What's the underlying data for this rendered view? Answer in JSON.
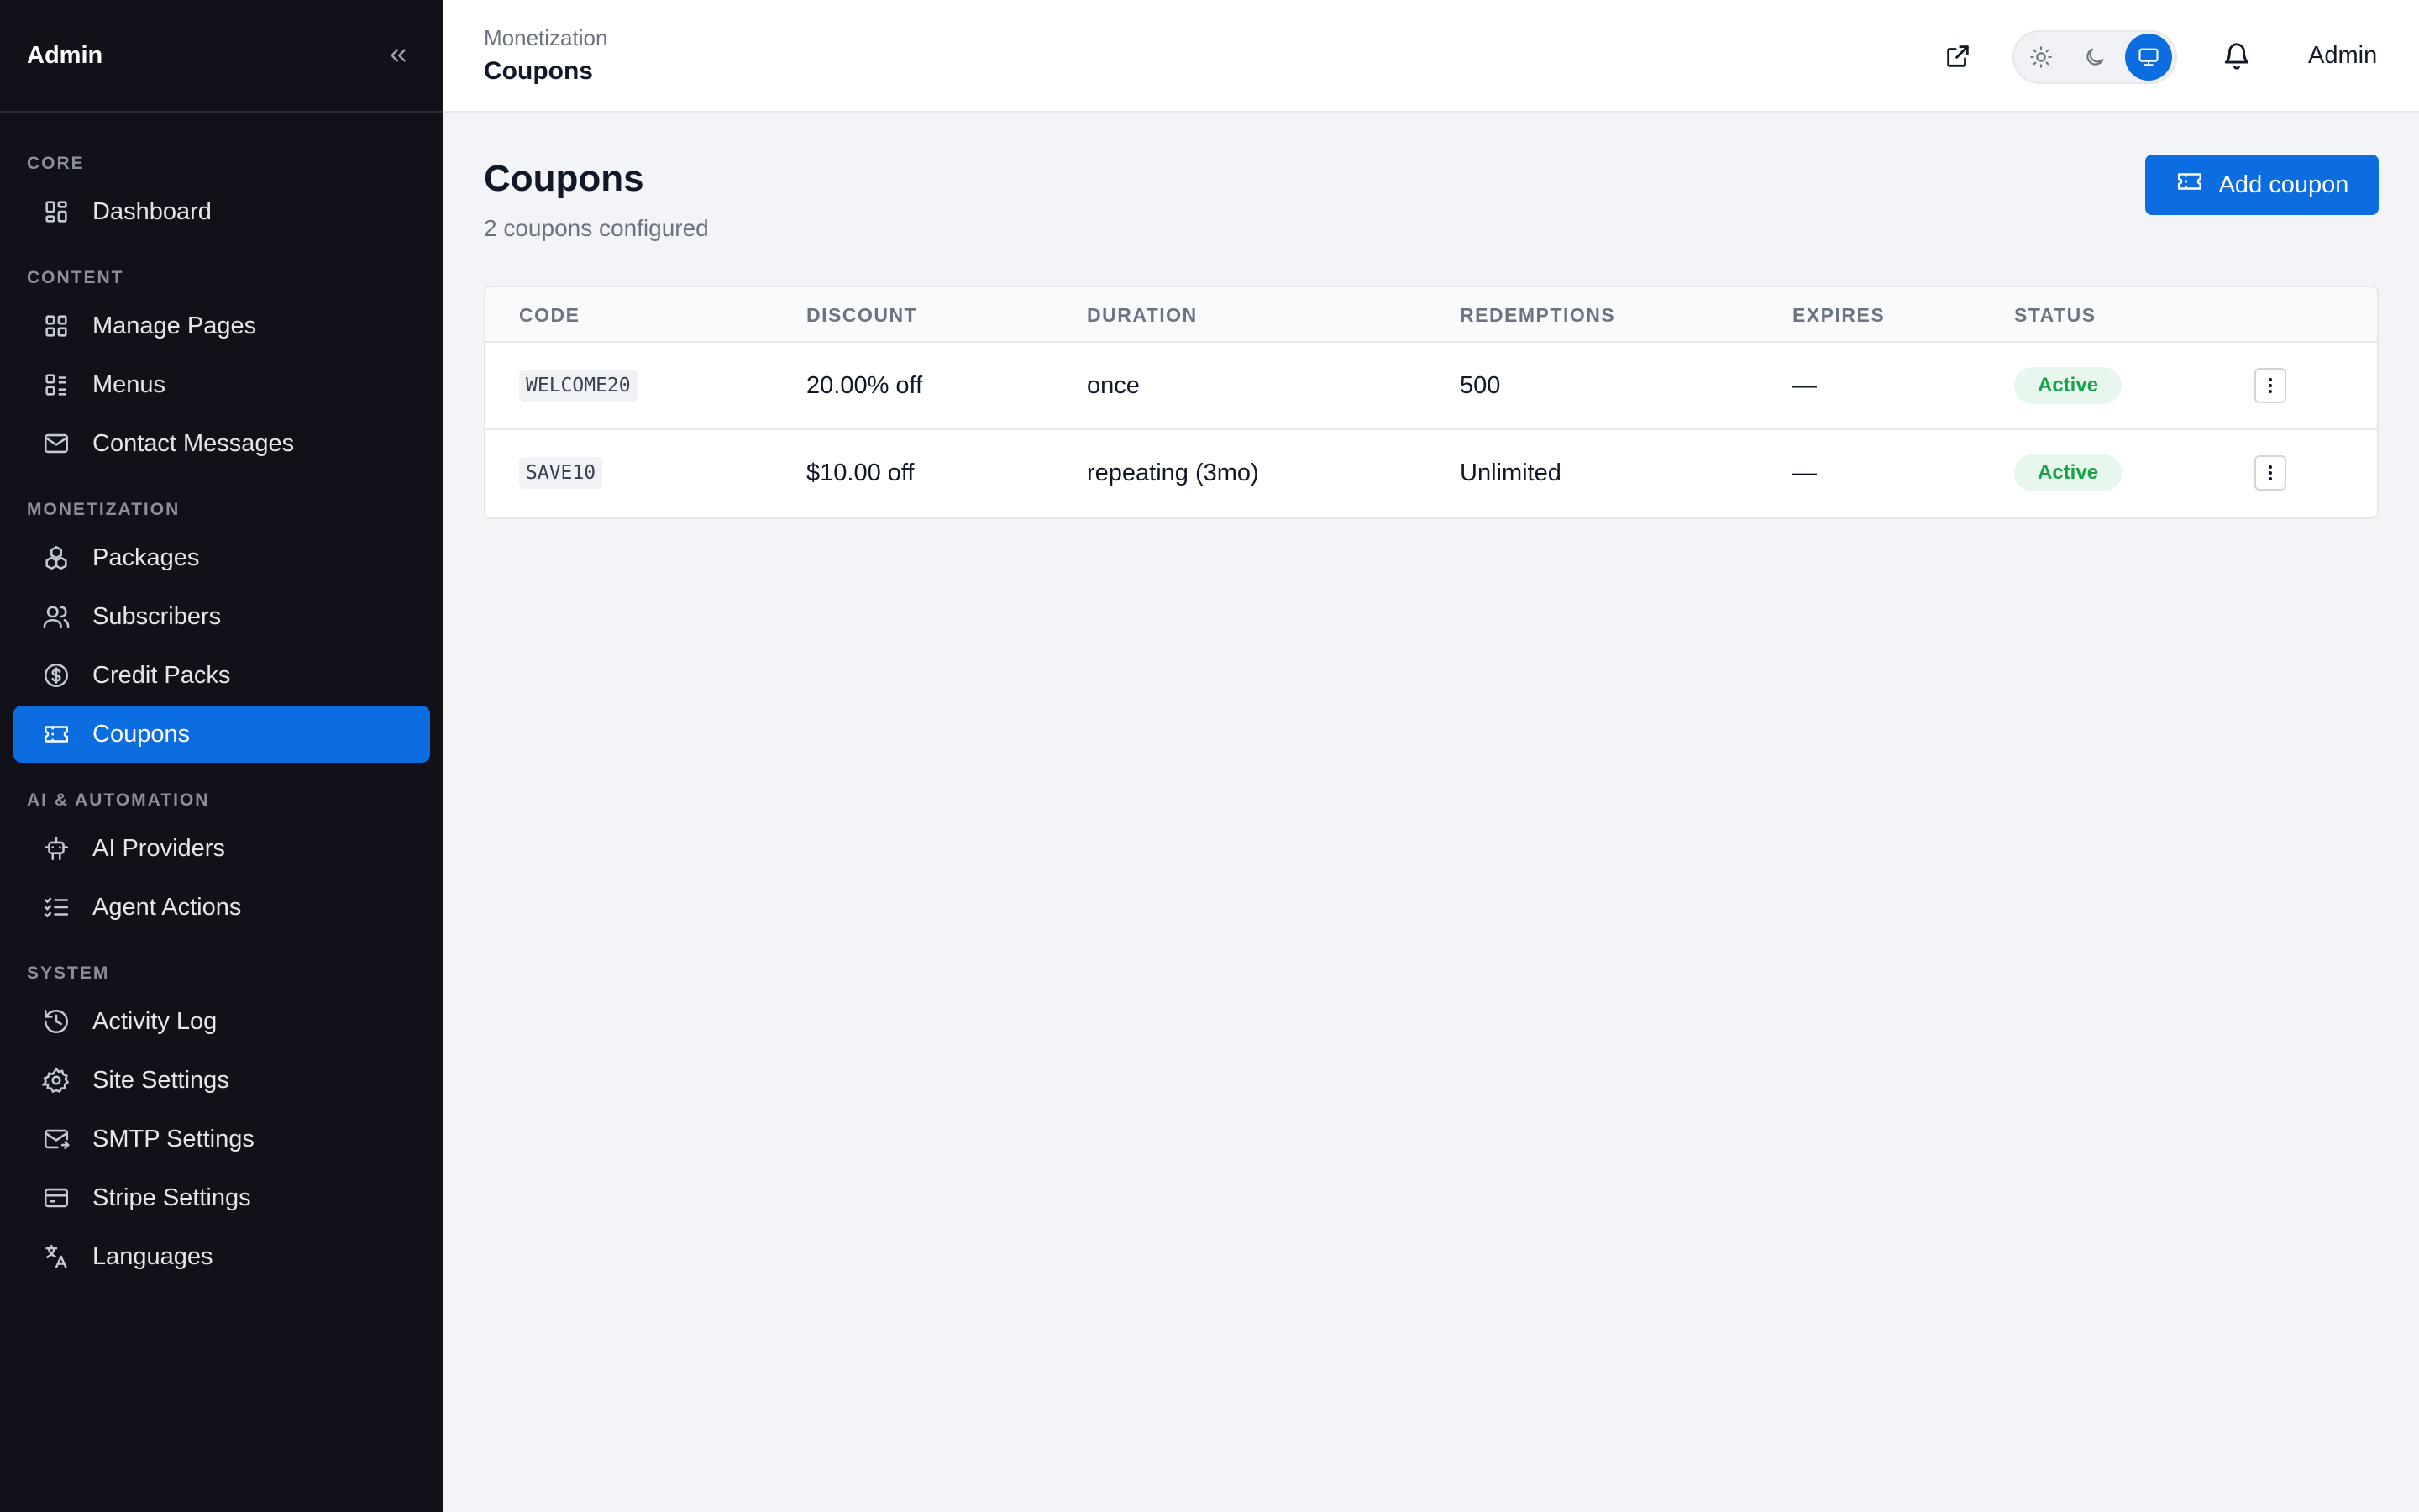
{
  "sidebar": {
    "brand": "Admin",
    "sections": [
      {
        "title": "CORE",
        "items": [
          {
            "label": "Dashboard",
            "icon": "dashboard-icon"
          }
        ]
      },
      {
        "title": "CONTENT",
        "items": [
          {
            "label": "Manage Pages",
            "icon": "pages-grid-icon"
          },
          {
            "label": "Menus",
            "icon": "menu-list-icon"
          },
          {
            "label": "Contact Messages",
            "icon": "mail-icon"
          }
        ]
      },
      {
        "title": "MONETIZATION",
        "items": [
          {
            "label": "Packages",
            "icon": "boxes-icon"
          },
          {
            "label": "Subscribers",
            "icon": "users-icon"
          },
          {
            "label": "Credit Packs",
            "icon": "dollar-circle-icon"
          },
          {
            "label": "Coupons",
            "icon": "ticket-icon",
            "active": true
          }
        ]
      },
      {
        "title": "AI & AUTOMATION",
        "items": [
          {
            "label": "AI Providers",
            "icon": "robot-icon"
          },
          {
            "label": "Agent Actions",
            "icon": "checklist-icon"
          }
        ]
      },
      {
        "title": "SYSTEM",
        "items": [
          {
            "label": "Activity Log",
            "icon": "history-icon"
          },
          {
            "label": "Site Settings",
            "icon": "gear-icon"
          },
          {
            "label": "SMTP Settings",
            "icon": "mail-send-icon"
          },
          {
            "label": "Stripe Settings",
            "icon": "credit-card-icon"
          },
          {
            "label": "Languages",
            "icon": "translate-icon"
          }
        ]
      }
    ]
  },
  "topbar": {
    "breadcrumb": "Monetization",
    "title": "Coupons",
    "user": "Admin",
    "theme_active": "system"
  },
  "main": {
    "title": "Coupons",
    "subtitle": "2 coupons configured",
    "add_button": "Add coupon"
  },
  "table": {
    "columns": [
      "CODE",
      "DISCOUNT",
      "DURATION",
      "REDEMPTIONS",
      "EXPIRES",
      "STATUS"
    ],
    "rows": [
      {
        "code": "WELCOME20",
        "discount": "20.00% off",
        "duration": "once",
        "redemptions": "500",
        "expires": "—",
        "status": "Active"
      },
      {
        "code": "SAVE10",
        "discount": "$10.00 off",
        "duration": "repeating (3mo)",
        "redemptions": "Unlimited",
        "expires": "—",
        "status": "Active"
      }
    ]
  },
  "colors": {
    "accent": "#0b6ddf",
    "sidebar_bg": "#111219",
    "status_active": "#16a34a"
  }
}
